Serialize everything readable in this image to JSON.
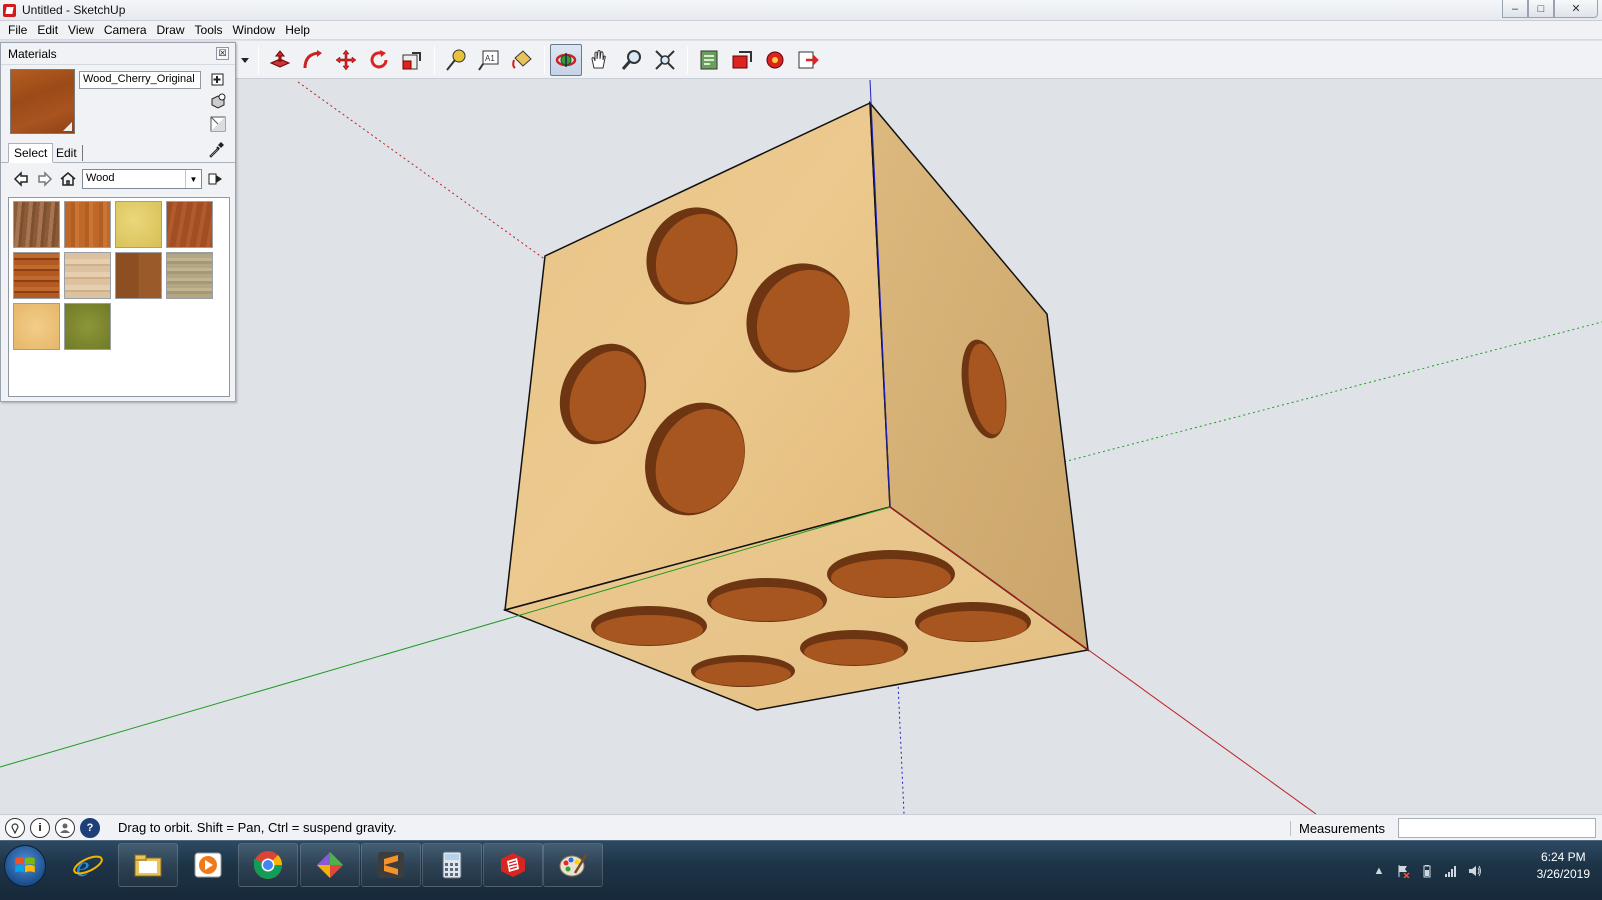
{
  "window": {
    "title": "Untitled - SketchUp",
    "minimize": "–",
    "maximize": "□",
    "close": "✕"
  },
  "menu": {
    "items": [
      {
        "label": "File",
        "key": "F"
      },
      {
        "label": "Edit",
        "key": "E"
      },
      {
        "label": "View",
        "key": "V"
      },
      {
        "label": "Camera",
        "key": "C"
      },
      {
        "label": "Draw",
        "key": "D"
      },
      {
        "label": "Tools",
        "key": "T"
      },
      {
        "label": "Window",
        "key": "W"
      },
      {
        "label": "Help",
        "key": "H"
      }
    ]
  },
  "toolbar": {
    "tools": [
      "push-pull",
      "follow-me",
      "move",
      "rotate",
      "scale",
      "tape-measure",
      "text",
      "paint-bucket",
      "orbit",
      "pan",
      "zoom",
      "zoom-extents",
      "get-models",
      "share-model",
      "extension-warehouse",
      "send-to-layout"
    ],
    "active_tool": "orbit"
  },
  "materials_panel": {
    "title": "Materials",
    "close_label": "☒",
    "current_material": "Wood_Cherry_Original",
    "tabs": {
      "select": "Select",
      "edit": "Edit"
    },
    "library": "Wood",
    "swatches": [
      {
        "name": "wood-swatch-1",
        "color": "#9a6a45"
      },
      {
        "name": "wood-swatch-2",
        "color": "#c06a2a"
      },
      {
        "name": "wood-swatch-3",
        "color": "#e0cc6a"
      },
      {
        "name": "wood-swatch-4",
        "color": "#a24e24"
      },
      {
        "name": "wood-swatch-5",
        "color": "#b55a22"
      },
      {
        "name": "wood-swatch-6",
        "color": "#dcc19e"
      },
      {
        "name": "wood-swatch-7",
        "color": "#8d4f22"
      },
      {
        "name": "wood-swatch-8",
        "color": "#b3a683"
      },
      {
        "name": "wood-swatch-9",
        "color": "#f0c57e"
      },
      {
        "name": "wood-swatch-10",
        "color": "#7e8830"
      }
    ]
  },
  "statusbar": {
    "hint": "Drag to orbit. Shift = Pan, Ctrl = suspend gravity.",
    "measurements_label": "Measurements",
    "measurements_value": ""
  },
  "taskbar": {
    "apps": [
      "internet-explorer",
      "file-explorer",
      "media-player",
      "chrome",
      "app-launcher",
      "sublime-text",
      "calculator",
      "sketchup",
      "paint"
    ],
    "clock_time": "6:24 PM",
    "clock_date": "3/26/2019"
  },
  "colors": {
    "face_light": "#e9c585",
    "face_dark": "#d8b379",
    "hole": "#9c4e1f",
    "axis_red": "#c02020",
    "axis_green": "#1f9a1f",
    "axis_blue": "#2020c0"
  }
}
